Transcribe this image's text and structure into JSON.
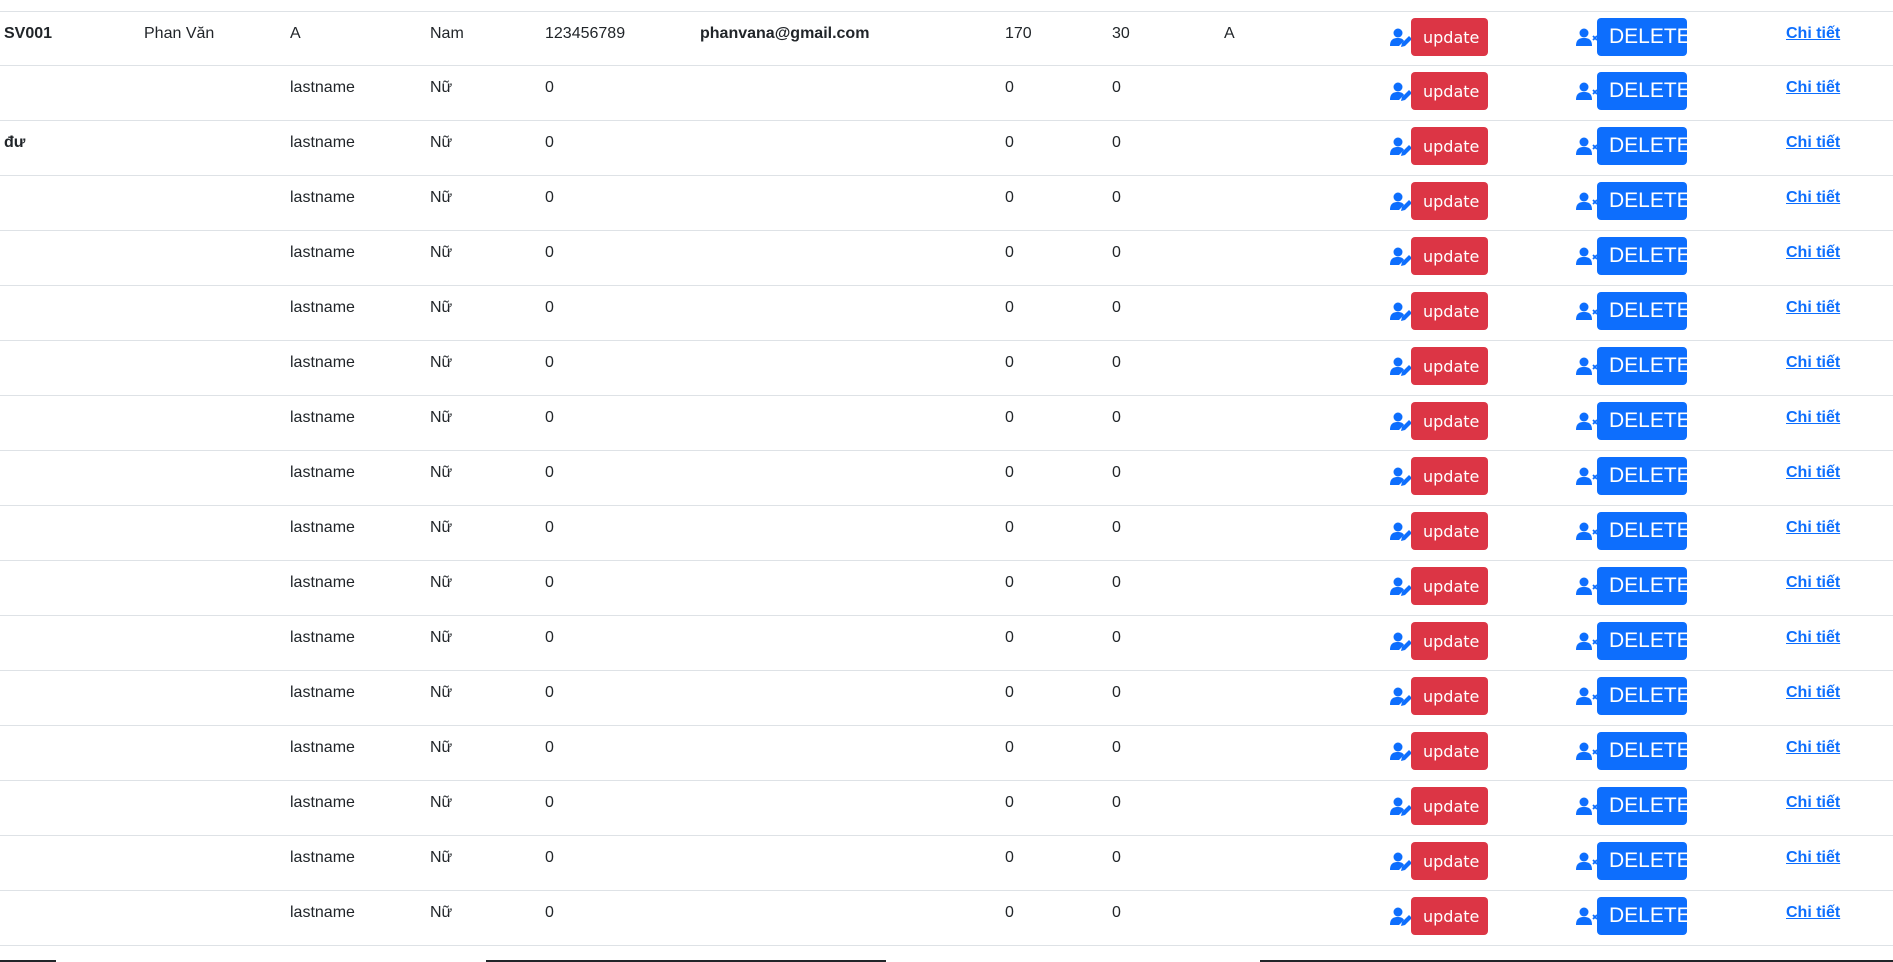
{
  "colors": {
    "update": "#dc3545",
    "delete": "#0d6efd",
    "link": "#0d6efd"
  },
  "icons": {
    "edit": "user-edit-icon",
    "delete": "user-delete-icon"
  },
  "rows": [
    {
      "id": "SV001",
      "first": "Phan Văn",
      "last": "A",
      "gender": "Nam",
      "phone": "123456789",
      "email": "phanvana@gmail.com",
      "height": "170",
      "weight": "30",
      "grade": "A",
      "update": "update",
      "delete": "DELETE",
      "detail": "Chi tiết"
    },
    {
      "id": "",
      "first": "",
      "last": "lastname",
      "gender": "Nữ",
      "phone": "0",
      "email": "",
      "height": "0",
      "weight": "0",
      "grade": "",
      "update": "update",
      "delete": "DELETE",
      "detail": "Chi tiết"
    },
    {
      "id": "đư",
      "first": "",
      "last": "lastname",
      "gender": "Nữ",
      "phone": "0",
      "email": "",
      "height": "0",
      "weight": "0",
      "grade": "",
      "update": "update",
      "delete": "DELETE",
      "detail": "Chi tiết"
    },
    {
      "id": "",
      "first": "",
      "last": "lastname",
      "gender": "Nữ",
      "phone": "0",
      "email": "",
      "height": "0",
      "weight": "0",
      "grade": "",
      "update": "update",
      "delete": "DELETE",
      "detail": "Chi tiết"
    },
    {
      "id": "",
      "first": "",
      "last": "lastname",
      "gender": "Nữ",
      "phone": "0",
      "email": "",
      "height": "0",
      "weight": "0",
      "grade": "",
      "update": "update",
      "delete": "DELETE",
      "detail": "Chi tiết"
    },
    {
      "id": "",
      "first": "",
      "last": "lastname",
      "gender": "Nữ",
      "phone": "0",
      "email": "",
      "height": "0",
      "weight": "0",
      "grade": "",
      "update": "update",
      "delete": "DELETE",
      "detail": "Chi tiết"
    },
    {
      "id": "",
      "first": "",
      "last": "lastname",
      "gender": "Nữ",
      "phone": "0",
      "email": "",
      "height": "0",
      "weight": "0",
      "grade": "",
      "update": "update",
      "delete": "DELETE",
      "detail": "Chi tiết"
    },
    {
      "id": "",
      "first": "",
      "last": "lastname",
      "gender": "Nữ",
      "phone": "0",
      "email": "",
      "height": "0",
      "weight": "0",
      "grade": "",
      "update": "update",
      "delete": "DELETE",
      "detail": "Chi tiết"
    },
    {
      "id": "",
      "first": "",
      "last": "lastname",
      "gender": "Nữ",
      "phone": "0",
      "email": "",
      "height": "0",
      "weight": "0",
      "grade": "",
      "update": "update",
      "delete": "DELETE",
      "detail": "Chi tiết"
    },
    {
      "id": "",
      "first": "",
      "last": "lastname",
      "gender": "Nữ",
      "phone": "0",
      "email": "",
      "height": "0",
      "weight": "0",
      "grade": "",
      "update": "update",
      "delete": "DELETE",
      "detail": "Chi tiết"
    },
    {
      "id": "",
      "first": "",
      "last": "lastname",
      "gender": "Nữ",
      "phone": "0",
      "email": "",
      "height": "0",
      "weight": "0",
      "grade": "",
      "update": "update",
      "delete": "DELETE",
      "detail": "Chi tiết"
    },
    {
      "id": "",
      "first": "",
      "last": "lastname",
      "gender": "Nữ",
      "phone": "0",
      "email": "",
      "height": "0",
      "weight": "0",
      "grade": "",
      "update": "update",
      "delete": "DELETE",
      "detail": "Chi tiết"
    },
    {
      "id": "",
      "first": "",
      "last": "lastname",
      "gender": "Nữ",
      "phone": "0",
      "email": "",
      "height": "0",
      "weight": "0",
      "grade": "",
      "update": "update",
      "delete": "DELETE",
      "detail": "Chi tiết"
    },
    {
      "id": "",
      "first": "",
      "last": "lastname",
      "gender": "Nữ",
      "phone": "0",
      "email": "",
      "height": "0",
      "weight": "0",
      "grade": "",
      "update": "update",
      "delete": "DELETE",
      "detail": "Chi tiết"
    },
    {
      "id": "",
      "first": "",
      "last": "lastname",
      "gender": "Nữ",
      "phone": "0",
      "email": "",
      "height": "0",
      "weight": "0",
      "grade": "",
      "update": "update",
      "delete": "DELETE",
      "detail": "Chi tiết"
    },
    {
      "id": "",
      "first": "",
      "last": "lastname",
      "gender": "Nữ",
      "phone": "0",
      "email": "",
      "height": "0",
      "weight": "0",
      "grade": "",
      "update": "update",
      "delete": "DELETE",
      "detail": "Chi tiết"
    },
    {
      "id": "",
      "first": "",
      "last": "lastname",
      "gender": "Nữ",
      "phone": "0",
      "email": "",
      "height": "0",
      "weight": "0",
      "grade": "",
      "update": "update",
      "delete": "DELETE",
      "detail": "Chi tiết"
    }
  ]
}
